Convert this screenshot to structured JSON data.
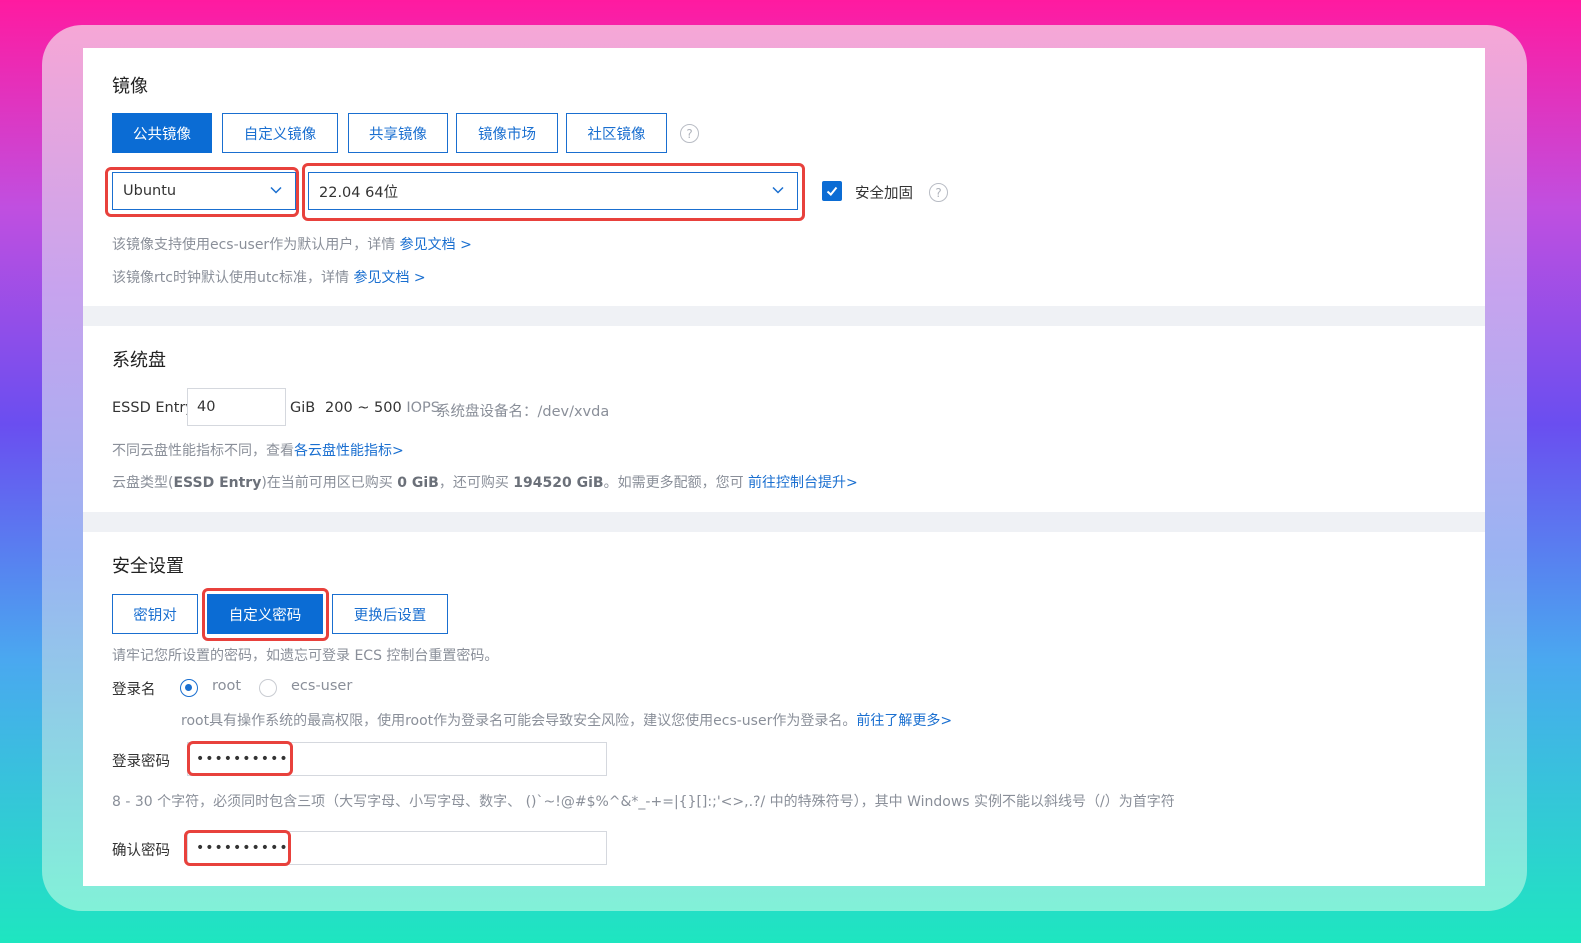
{
  "image_section": {
    "title": "镜像",
    "tabs": [
      {
        "label": "公共镜像",
        "active": true
      },
      {
        "label": "自定义镜像",
        "active": false
      },
      {
        "label": "共享镜像",
        "active": false
      },
      {
        "label": "镜像市场",
        "active": false
      },
      {
        "label": "社区镜像",
        "active": false
      }
    ],
    "os_select": "Ubuntu",
    "version_select": "22.04 64位",
    "security_label": "安全加固",
    "security_checked": true,
    "note1_text": "该镜像支持使用ecs-user作为默认用户，详情",
    "note1_link": "参见文档 >",
    "note2_text": "该镜像rtc时钟默认使用utc标准，详情",
    "note2_link": "参见文档 >"
  },
  "disk_section": {
    "title": "系统盘",
    "disk_type": "ESSD Entry",
    "size_value": "40",
    "unit": "GiB",
    "iops_range": "200 ~ 500",
    "iops_label": "IOPS",
    "device_label": "系统盘设备名：",
    "device_value": "/dev/xvda",
    "perf_text": "不同云盘性能指标不同，查看",
    "perf_link": "各云盘性能指标>",
    "quota_pre": "云盘类型(",
    "quota_type": "ESSD Entry",
    "quota_mid1": ")在当前可用区已购买",
    "quota_bought": "0 GiB",
    "quota_mid2": "，还可购买",
    "quota_avail": "194520 GiB",
    "quota_post": "。如需更多配额，您可",
    "quota_link": "前往控制台提升>"
  },
  "security_section": {
    "title": "安全设置",
    "tabs": [
      {
        "label": "密钥对",
        "active": false
      },
      {
        "label": "自定义密码",
        "active": true
      },
      {
        "label": "更换后设置",
        "active": false
      }
    ],
    "remember_note": "请牢记您所设置的密码，如遗忘可登录 ECS 控制台重置密码。",
    "login_label": "登录名",
    "login_options": [
      {
        "label": "root",
        "selected": true
      },
      {
        "label": "ecs-user",
        "selected": false
      }
    ],
    "root_warning": "root具有操作系统的最高权限，使用root作为登录名可能会导致安全风险，建议您使用ecs-user作为登录名。",
    "root_warning_link": "前往了解更多>",
    "password_label": "登录密码",
    "password_value": "••••••••••",
    "password_rule": "8 - 30 个字符，必须同时包含三项（大写字母、小写字母、数字、 ()`~!@#$%^&*_-+=|{}[]:;'<>,.?/ 中的特殊符号），其中 Windows 实例不能以斜线号（/）为首字符",
    "confirm_label": "确认密码",
    "confirm_value": "••••••••••"
  },
  "colors": {
    "primary": "#0b6cd4",
    "highlight": "#e8413c",
    "separator": "#eff1f5"
  }
}
